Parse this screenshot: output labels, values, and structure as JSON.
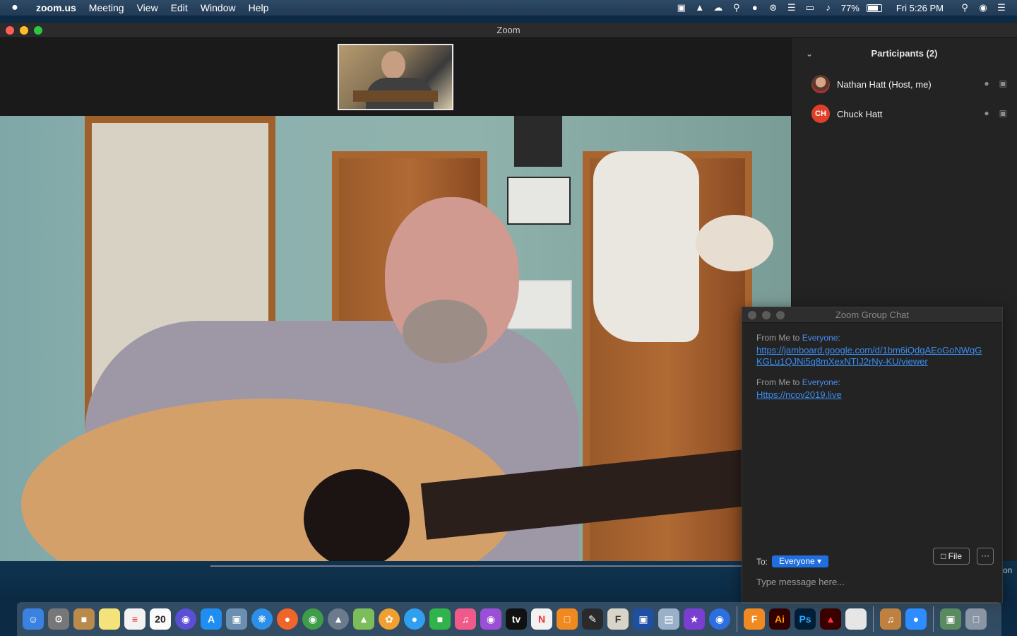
{
  "menubar": {
    "apple": "",
    "items": [
      "zoom.us",
      "Meeting",
      "View",
      "Edit",
      "Window",
      "Help"
    ],
    "battery": "77%",
    "clock": "Fri 5:26 PM"
  },
  "window": {
    "title": "Zoom"
  },
  "participants": {
    "title": "Participants (2)",
    "list": [
      {
        "name": "Nathan Hatt (Host, me)"
      },
      {
        "name": "Chuck Hatt",
        "initials": "CH"
      }
    ]
  },
  "chat": {
    "title": "Zoom Group Chat",
    "messages": [
      {
        "from": "From Me to ",
        "to": "Everyone",
        "suffix": ":",
        "link": "https://jamboard.google.com/d/1bm6iQdgAEoGoNWqGKGLu1QJNi5q8mXexNTIJ2rNy-KU/viewer"
      },
      {
        "from": "From Me to ",
        "to": "Everyone",
        "suffix": ":",
        "link": "Https://ncov2019.live"
      }
    ],
    "to_label": "To:",
    "recipient": "Everyone",
    "file_label": "File",
    "more_label": "···",
    "input_placeholder": "Type message here..."
  },
  "desktop": {
    "partial_text": "on"
  },
  "dock": {
    "calendar_day": "20",
    "illustrator": "Ai",
    "photoshop": "Ps"
  },
  "colors": {
    "accent": "#1f6fe0",
    "link": "#3a8df0",
    "avatar_ch": "#e0402a"
  }
}
